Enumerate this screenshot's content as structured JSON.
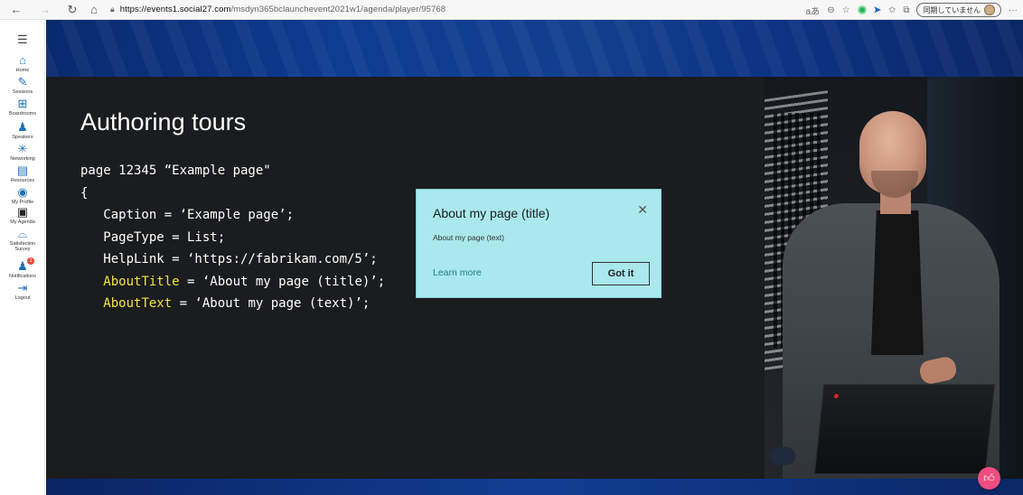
{
  "browser": {
    "url_host": "https://events1.social27.com",
    "url_path": "/msdyn365bclaunchevent2021w1/agenda/player/95768",
    "sync_label": "同期していません",
    "read_aloud": "aあ",
    "more": "···"
  },
  "sidebar": {
    "items": [
      {
        "label": "Home",
        "icon": "home-icon"
      },
      {
        "label": "Sessions",
        "icon": "pencil-icon"
      },
      {
        "label": "Boardrooms",
        "icon": "boardroom-icon"
      },
      {
        "label": "Speakers",
        "icon": "speakers-icon"
      },
      {
        "label": "Networking",
        "icon": "networking-icon"
      },
      {
        "label": "Resources",
        "icon": "resources-icon"
      },
      {
        "label": "My Profile",
        "icon": "profile-icon"
      },
      {
        "label": "My Agenda",
        "icon": "agenda-icon"
      },
      {
        "label": "Satisfaction Survey",
        "icon": "survey-icon"
      },
      {
        "label": "Notifications",
        "icon": "bell-icon",
        "badge": "1"
      },
      {
        "label": "Logout",
        "icon": "logout-icon"
      }
    ]
  },
  "slide": {
    "title": "Authoring tours",
    "code": {
      "line1": "page 12345 “Example page\"",
      "line2": "{",
      "line3": "   Caption = ‘Example page’;",
      "line4": "   PageType = List;",
      "line5": "   HelpLink = ‘https://fabrikam.com/5’;",
      "line6_key": "AboutTitle",
      "line6_rest": " = ‘About my page (title)’;",
      "line7_key": "AboutText",
      "line7_rest": " = ‘About my page (text)’;"
    }
  },
  "tour_card": {
    "title": "About my page (title)",
    "text": "About my page (text)",
    "learn_more": "Learn more",
    "got_it": "Got it",
    "close": "✕"
  },
  "colors": {
    "accent_yellow": "#f2e445",
    "tour_bg": "#a9e8ec",
    "link": "#24807f",
    "nav_icon": "#1d6fb8",
    "like": "#ee4d80"
  }
}
